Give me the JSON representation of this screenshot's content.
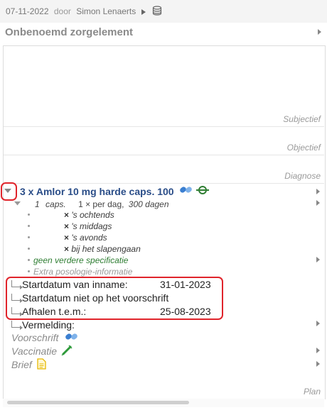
{
  "header": {
    "date": "07-11-2022",
    "by_label": "door",
    "author": "Simon Lenaerts",
    "title": "Onbenoemd zorgelement"
  },
  "sections": {
    "subjectief": "Subjectief",
    "objectief": "Objectief",
    "diagnose": "Diagnose",
    "plan": "Plan"
  },
  "medication": {
    "title": "3 x Amlor 10 mg harde caps. 100",
    "dosage": {
      "amount": "1",
      "unit": "caps.",
      "frequency": "1 × per dag,",
      "duration": "300 dagen"
    },
    "schedule": [
      {
        "mark": "×",
        "label": "'s ochtends"
      },
      {
        "mark": "×",
        "label": "'s middags"
      },
      {
        "mark": "×",
        "label": "'s avonds"
      },
      {
        "mark": "×",
        "label": "bij het slapengaan"
      }
    ],
    "no_spec": "geen verdere specificatie",
    "extra_info": "Extra posologie-informatie",
    "fields": {
      "start_label": "Startdatum van inname:",
      "start_value": "31-01-2023",
      "not_on_prescription": "Startdatum niet op het voorschrift",
      "pickup_label": "Afhalen t.e.m.:",
      "pickup_value": "25-08-2023"
    },
    "mention_label": "Vermelding:",
    "links": {
      "prescription": "Voorschrift",
      "vaccination": "Vaccinatie",
      "letter": "Brief"
    }
  },
  "colors": {
    "highlight": "#e0242b",
    "med_title": "#2a4d88",
    "pill_blue": "#3b7fd1",
    "green": "#2e7d32",
    "letter_yellow": "#e6b800"
  }
}
